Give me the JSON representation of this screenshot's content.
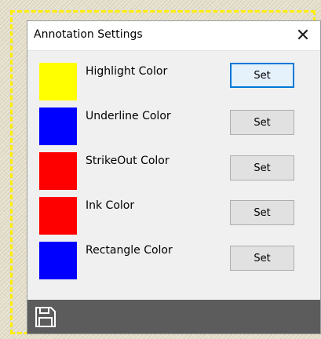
{
  "dialog": {
    "title": "Annotation Settings",
    "close_label": "✕"
  },
  "rows": [
    {
      "label": "Highlight Color",
      "color": "#ffff00",
      "button": "Set"
    },
    {
      "label": "Underline Color",
      "color": "#0000ff",
      "button": "Set"
    },
    {
      "label": "StrikeOut Color",
      "color": "#ff0000",
      "button": "Set"
    },
    {
      "label": "Ink Color",
      "color": "#ff0000",
      "button": "Set"
    },
    {
      "label": "Rectangle Color",
      "color": "#0000ff",
      "button": "Set"
    }
  ],
  "footer": {
    "icon": "save-icon"
  }
}
